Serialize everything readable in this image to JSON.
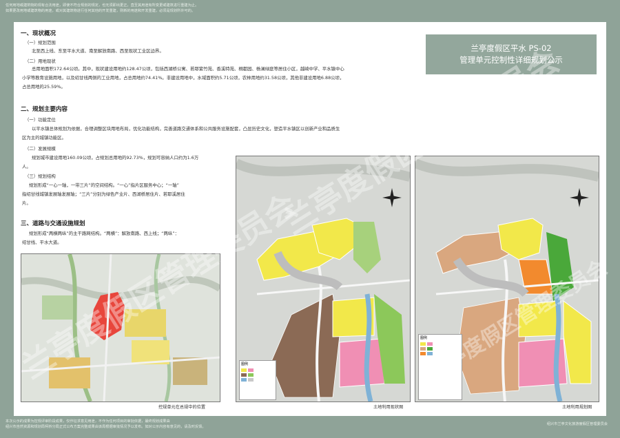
{
  "top_notes": [
    "任何用地或建筑物的现有合法用途，即使不符合规划的规定，也无须即出更正。直至其用途有所变更或建筑进行重建为止。",
    "如果更改用地或建筑物的用途，或对其建筑物进行任何其他的开发重建，则新的用途和开发重建，必须是规划所许可的。"
  ],
  "title": {
    "line1": "兰亭度假区平水 PS-02",
    "line2": "管理单元控制性详细规划公示"
  },
  "sections": {
    "s1_title": "一、现状概况",
    "s1_sub1": "（一）规划范围",
    "s1_p1": "北至西上线、东至平水大道、南至解放南路、西至现状工业区边界。",
    "s1_sub2": "（二）用地现状",
    "s1_p2a": "总用地面积172.64公顷。其中，现状建设用地约128.47公顷，包括西湖桥公寓、若耶紫竹苑、香溪特苑、桐都园、杨澜绿庭等居住小区，越崎中学、平水镇中心",
    "s1_p2b": "小学等教育设施用地，以及绍甘线两侧的工业用地，占总用地约74.41%。非建设用地中，水域面积约5.71公顷，农林用地约31.58公顷，其他非建设用地6.88公顷，",
    "s1_p2c": "占总用地的25.59%。",
    "s2_title": "二、规划主要内容",
    "s2_sub1": "（一）功能定位",
    "s2_p1a": "以平水镇总体规划为依据，合理调整区块用地布局，优化功能结构，完善道路交通体系和公共服务设施配套，凸显历史文化，塑造平水镇区以创新产业和品质生",
    "s2_p1b": "区为主的城镇功能区。",
    "s2_sub2": "（二）发展规模",
    "s2_p2a": "规划城市建设用地160.09公顷，占规划总用地的92.73%，规划可容纳人口约为1.6万",
    "s2_p2b": "人。",
    "s2_sub3": "（三）规划结构",
    "s2_p3a": "规划形成“一心一轴，一带三片”的空间结构。“一心”指片区服务中心；“一轴”",
    "s2_p3b": "指绍甘线城镇发展轴发展轴；“三片”分别为绿色产业片、西湖桥居住片、若耶溪居住",
    "s2_p3c": "片。",
    "s3_title": "三、道路与交通设施规划",
    "s3_p1a": "规划形成“两横两纵”的主干路网结构。“两横”：解放南路、西上线；“两纵”：",
    "s3_p1b": "绍甘线、平水大道。"
  },
  "captions": {
    "location": "控规单元在总规中的位置",
    "current": "土地利用现状图",
    "plan": "土地利用规划图"
  },
  "legend_title": "图例",
  "bottom_notes": [
    "本次公示的成果为控规评审阶段成果，仅作征求意见用途，不作为任何项目的审批依据，最终规划成果由",
    "绍兴市自然资源和规划局柯桥分局正式公布方案完整成果由该局根据审批情况予以发布。如对公示内容有意见的，请及时反馈。"
  ],
  "bottom_right": "绍兴市兰亭文化旅游度假区管理委员会",
  "watermarks": [
    "兰亭度假区管理委员会",
    "兰亭度假区管理委员会",
    "兰亭度假区管理委员会"
  ],
  "colors": {
    "background": "#8fa398",
    "title_box": "#93a79c",
    "residential": "#f2e84a",
    "industrial": "#8b6a55",
    "commercial": "#f08fb4",
    "green": "#8cc85a",
    "water": "#7fb2d6"
  }
}
